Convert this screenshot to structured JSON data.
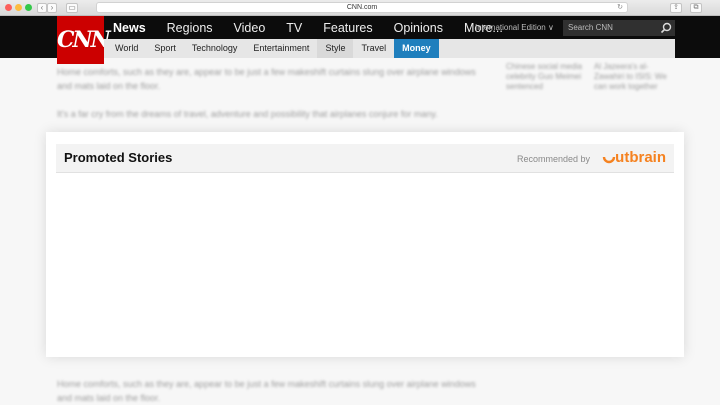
{
  "browser": {
    "url": "CNN.com",
    "reload_glyph": "↻",
    "back_glyph": "‹",
    "forward_glyph": "›",
    "share_glyph": "⇪",
    "tabs_glyph": "⧉",
    "sidebar_glyph": "▭"
  },
  "header": {
    "logo": "CNN",
    "main_nav": [
      "News",
      "Regions",
      "Video",
      "TV",
      "Features",
      "Opinions",
      "More..."
    ],
    "active_main": "News",
    "edition": "International Edition ∨",
    "search_placeholder": "Search CNN",
    "sub_nav": [
      "World",
      "Sport",
      "Technology",
      "Entertainment",
      "Style",
      "Travel",
      "Money"
    ],
    "selected_sub": "Money",
    "accent_color": "#cc0000",
    "money_color": "#1f7fbd"
  },
  "article": {
    "para1": "Home comforts, such as they are, appear to be just a few makeshift curtains slung over airplane windows and mats laid on the floor.",
    "para2": "It's a far cry from the dreams of travel, adventure and possibility that airplanes conjure for many.",
    "side1": "Chinese social media celebrity Guo Meimei sentenced",
    "side2": "Al Jazeera's al-Zawahiri to ISIS: We can work together",
    "para3": "Home comforts, such as they are, appear to be just a few makeshift curtains slung over airplane windows and mats laid on the floor."
  },
  "promo": {
    "title": "Promoted Stories",
    "recommended_label": "Recommended by",
    "brand": "Outbrain",
    "brand_color": "#f58220"
  }
}
